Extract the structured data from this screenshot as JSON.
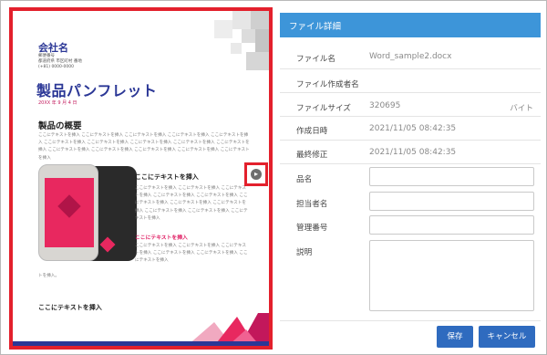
{
  "preview": {
    "company": "会社名",
    "address_lines": [
      "郵便番号",
      "都道府県 市区町村 番地",
      "(+81) 0000-0000"
    ],
    "title": "製品パンフレット",
    "date": "20XX 年 9 月 4 日",
    "heading": "製品の概要",
    "intro_text": "ここにテキストを挿入 ここにテキストを挿入 ここにテキストを挿入 ここにテキストを挿入 ここにテキストを挿入 ここにテキストを挿入 ここにテキストを挿入 ここにテキストを挿入 ここにテキストを挿入 ここにテキストを挿入 ここにテキストを挿入 ここにテキストを挿入 ここにテキストを挿入 ここにテキストを挿入 ここにテキストを挿入",
    "sub_heading": "ここにテキストを挿入",
    "body_text": "ここにテキストを挿入 ここにテキストを挿入 ここにテキストを挿入 ここにテキストを挿入 ここにテキストを挿入 ここにテキストを挿入 ここにテキストを挿入 ここにテキストを挿入 ここにテキストを挿入 ここにテキストを挿入 ここにテキストを挿入",
    "pink_heading": "ここにテキストを挿入",
    "body_text2": "ここにテキストを挿入 ここにテキストを挿入 ここにテキストを挿入 ここにテキストを挿入 ここにテキストを挿入 ここにテキストを挿入",
    "tail_text": "トを挿入。",
    "bottom_heading": "ここにテキストを挿入"
  },
  "panel": {
    "title": "ファイル詳細",
    "file_name_label": "ファイル名",
    "file_name_value": "Word_sample2.docx",
    "creator_label": "ファイル作成者名",
    "creator_value": "",
    "size_label": "ファイルサイズ",
    "size_value": "320695",
    "size_unit": "バイト",
    "created_label": "作成日時",
    "created_value": "2021/11/05 08:42:35",
    "modified_label": "最終修正",
    "modified_value": "2021/11/05 08:42:35",
    "product_label": "品名",
    "person_label": "担当者名",
    "manage_label": "管理番号",
    "desc_label": "説明",
    "save_label": "保存",
    "cancel_label": "キャンセル"
  },
  "colors": {
    "highlight": "#e3202c",
    "header": "#3d95d9",
    "button": "#2f6bbf",
    "brand_blue": "#2b3796",
    "accent_pink": "#e8285f"
  },
  "icons": {
    "next_page": "arrow-right-circle-icon"
  }
}
